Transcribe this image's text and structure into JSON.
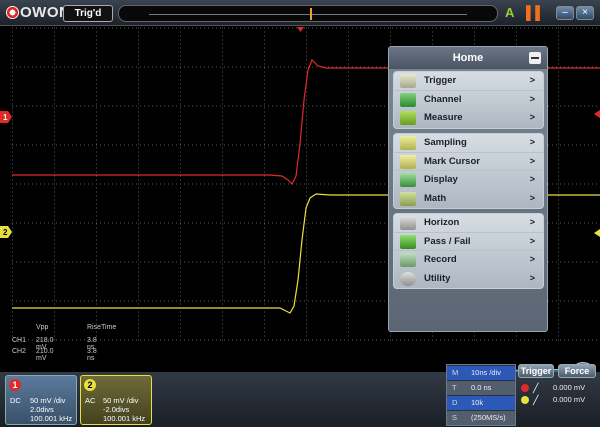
{
  "topbar": {
    "logo": "OWON",
    "trigger_state": "Trig'd",
    "auto_icon": "A",
    "run_icon": "▌▌",
    "min_label": "–",
    "close_label": "×"
  },
  "screen": {
    "ch1_marker": "1",
    "ch2_marker": "2",
    "measure": {
      "headers": [
        "Vpp",
        "RiseTime"
      ],
      "rows": [
        {
          "ch": "CH1",
          "vpp": "218.0 mV",
          "rise": "3.8 ns"
        },
        {
          "ch": "CH2",
          "vpp": "210.0 mV",
          "rise": "3.8 ns"
        }
      ]
    }
  },
  "home_menu": {
    "title": "Home",
    "groups": [
      [
        {
          "label": "Trigger",
          "arrow": ">",
          "icon": "trigger-icon"
        },
        {
          "label": "Channel",
          "arrow": ">",
          "icon": "channel-icon"
        },
        {
          "label": "Measure",
          "arrow": ">",
          "icon": "measure-icon"
        }
      ],
      [
        {
          "label": "Sampling",
          "arrow": ">",
          "icon": "sampling-icon"
        },
        {
          "label": "Mark Cursor",
          "arrow": ">",
          "icon": "cursor-icon"
        },
        {
          "label": "Display",
          "arrow": ">",
          "icon": "display-icon"
        },
        {
          "label": "Math",
          "arrow": ">",
          "icon": "math-icon"
        }
      ],
      [
        {
          "label": "Horizon",
          "arrow": ">",
          "icon": "horizon-icon"
        },
        {
          "label": "Pass / Fail",
          "arrow": ">",
          "icon": "pass-fail-icon"
        },
        {
          "label": "Record",
          "arrow": ">",
          "icon": "record-icon"
        },
        {
          "label": "Utility",
          "arrow": ">",
          "icon": "utility-icon"
        }
      ]
    ]
  },
  "channels": {
    "ch1": {
      "num": "1",
      "coupling": "DC",
      "scale": "50 mV /div",
      "offset": "2.0divs",
      "freq": "100.001 kHz"
    },
    "ch2": {
      "num": "2",
      "coupling": "AC",
      "scale": "50 mV /div",
      "offset": "-2.0divs",
      "freq": "100.001 kHz"
    }
  },
  "timebase": {
    "rows": [
      {
        "k": "M",
        "v": "10ns /div"
      },
      {
        "k": "T",
        "v": "0.0 ns"
      },
      {
        "k": "D",
        "v": "10k"
      },
      {
        "k": "S",
        "v": "(250MS/s)"
      }
    ]
  },
  "trigger_panel": {
    "trigger_btn": "Trigger",
    "force_btn": "Force",
    "ch1_level": "0.000 mV",
    "ch2_level": "0.000 mV"
  },
  "colors": {
    "ch1": "#e02a2a",
    "ch2": "#e8e040",
    "background": "#000000",
    "accent": "#2c59b8"
  }
}
